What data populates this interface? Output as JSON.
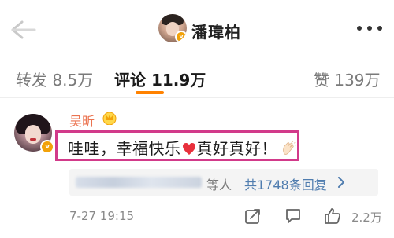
{
  "header": {
    "name": "潘瑋柏",
    "verified_badge": "v"
  },
  "tabs": [
    {
      "label": "转发 8.5万"
    },
    {
      "label": "评论 11.9万"
    },
    {
      "label": "赞 139万"
    }
  ],
  "colors": {
    "accent": "#ff8200",
    "author": "#eb7350",
    "link": "#507daf",
    "highlight_border": "#d23a8a"
  },
  "comment": {
    "author": "吴昕",
    "text_before_heart": "哇哇，幸福快乐",
    "text_after_heart": "真好真好！",
    "replies_suffix": "等人",
    "replies_link": "共1748条回复",
    "timestamp": "7-27 19:15",
    "like_count": "2.2万",
    "verified_badge": "v"
  },
  "icons": {
    "back": "back-arrow-icon",
    "more": "more-dots-icon",
    "crown": "crown-icon",
    "heart": "heart-icon",
    "clap": "clap-icon",
    "share": "share-icon",
    "comment": "comment-icon",
    "like": "like-icon"
  }
}
